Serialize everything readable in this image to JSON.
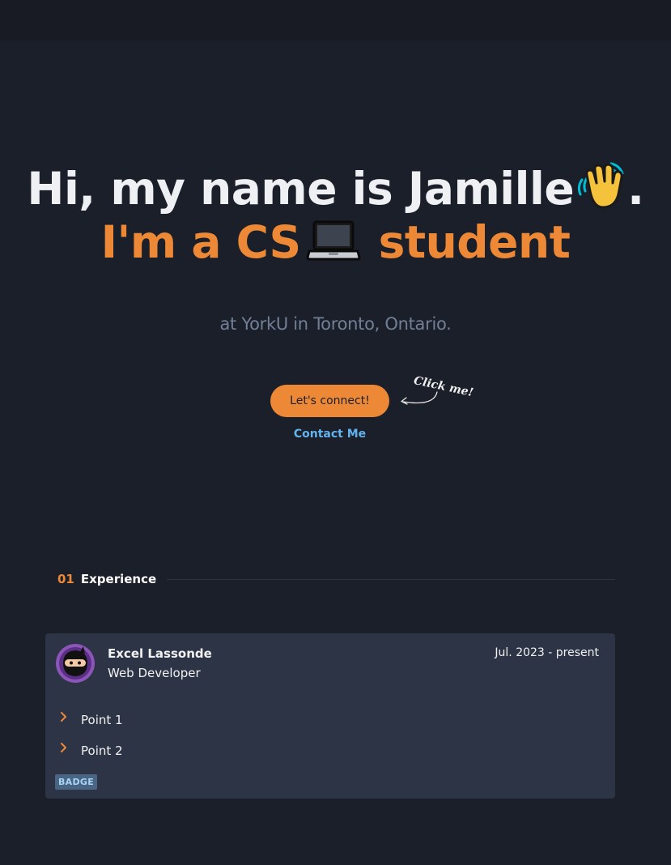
{
  "hero": {
    "greeting": "Hi, my name is Jamille",
    "greeting_end": ".",
    "wave_icon": "waving-hand-emoji",
    "tagline_start": "I'm a CS",
    "laptop_icon": "laptop-emoji",
    "tagline_end": "student",
    "subtitle": "at YorkU in Toronto, Ontario."
  },
  "cta": {
    "button_label": "Let's connect!",
    "click_hint": "Click me!",
    "contact_link": "Contact Me"
  },
  "section": {
    "number": "01",
    "title": "Experience"
  },
  "experience": {
    "company": "Excel Lassonde",
    "role": "Web Developer",
    "dates": "Jul. 2023 - present",
    "points": [
      "Point 1",
      "Point 2"
    ],
    "badge": "BADGE"
  },
  "colors": {
    "background": "#1b1f29",
    "accent": "#ed8936",
    "link": "#63b3ed",
    "card": "#2d3446"
  }
}
